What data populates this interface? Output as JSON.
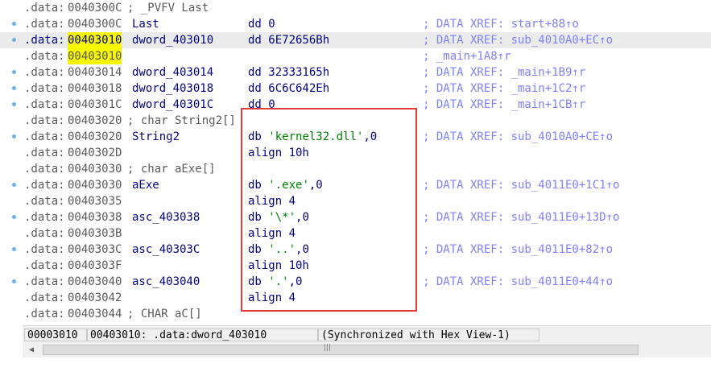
{
  "rows": [
    {
      "seg": ".data:",
      "addr": "0040300C",
      "comment": "; _PVFV Last",
      "dot": false
    },
    {
      "seg": ".data:",
      "addr": "0040300C",
      "name": "Last",
      "ins": "dd 0",
      "xref": "; DATA XREF: start+88↑o",
      "dot": true
    },
    {
      "seg": ".data:",
      "addr": "00403010",
      "name": "dword_403010",
      "ins": "dd 6E72656Bh",
      "xref": "; DATA XREF: sub_4010A0+EC↑o",
      "dot": true,
      "highlight": true,
      "yellow": true
    },
    {
      "seg": ".data:",
      "addr": "00403010",
      "xref": "; _main+1A8↑r",
      "dot": false,
      "yellow": true
    },
    {
      "seg": ".data:",
      "addr": "00403014",
      "name": "dword_403014",
      "ins": "dd 32333165h",
      "xref": "; DATA XREF: _main+1B9↑r",
      "dot": true
    },
    {
      "seg": ".data:",
      "addr": "00403018",
      "name": "dword_403018",
      "ins": "dd 6C6C642Eh",
      "xref": "; DATA XREF: _main+1C2↑r",
      "dot": true
    },
    {
      "seg": ".data:",
      "addr": "0040301C",
      "name": "dword_40301C",
      "ins": "dd 0",
      "xref": "; DATA XREF: _main+1CB↑r",
      "dot": true
    },
    {
      "seg": ".data:",
      "addr": "00403020",
      "comment": "; char String2[]",
      "dot": false
    },
    {
      "seg": ".data:",
      "addr": "00403020",
      "name": "String2",
      "ins_pre": "db ",
      "ins_str": "'kernel32.dll'",
      "ins_post": ",0",
      "xref": "; DATA XREF: sub_4010A0+CE↑o",
      "dot": true
    },
    {
      "seg": ".data:",
      "addr": "0040302D",
      "ins": "align 10h",
      "dot": false
    },
    {
      "seg": ".data:",
      "addr": "00403030",
      "comment": "; char aExe[]",
      "dot": false
    },
    {
      "seg": ".data:",
      "addr": "00403030",
      "name": "aExe",
      "ins_pre": "db ",
      "ins_str": "'.exe'",
      "ins_post": ",0",
      "xref": "; DATA XREF: sub_4011E0+1C1↑o",
      "dot": true
    },
    {
      "seg": ".data:",
      "addr": "00403035",
      "ins": "align 4",
      "dot": false
    },
    {
      "seg": ".data:",
      "addr": "00403038",
      "name": "asc_403038",
      "ins_pre": "db ",
      "ins_str": "'\\*'",
      "ins_post": ",0",
      "xref": "; DATA XREF: sub_4011E0+13D↑o",
      "dot": true
    },
    {
      "seg": ".data:",
      "addr": "0040303B",
      "ins": "align 4",
      "dot": false
    },
    {
      "seg": ".data:",
      "addr": "0040303C",
      "name": "asc_40303C",
      "ins_pre": "db ",
      "ins_str": "'..'",
      "ins_post": ",0",
      "xref": "; DATA XREF: sub_4011E0+82↑o",
      "dot": true
    },
    {
      "seg": ".data:",
      "addr": "0040303F",
      "ins": "align 10h",
      "dot": false
    },
    {
      "seg": ".data:",
      "addr": "00403040",
      "name": "asc_403040",
      "ins_pre": "db ",
      "ins_str": "'.'",
      "ins_post": ",0",
      "xref": "; DATA XREF: sub_4011E0+44↑o",
      "dot": true
    },
    {
      "seg": ".data:",
      "addr": "00403042",
      "ins": "align 4",
      "dot": false
    },
    {
      "seg": ".data:",
      "addr": "00403044",
      "comment": "; CHAR aC[]",
      "dot": false
    }
  ],
  "status": {
    "offset": "00003010",
    "location": "00403010: .data:dword_403010",
    "sync": "(Synchronized with Hex View-1)"
  },
  "scrollbar": {
    "left_arrow": "◀",
    "grip": "|||"
  },
  "colors": {
    "highlight_row": "#ebebeb",
    "yellow_address": "#f7f700",
    "annotation_box": "#e03a3a",
    "xref_comment": "#8080ff",
    "string_literal": "#008000",
    "instruction": "#000080"
  }
}
